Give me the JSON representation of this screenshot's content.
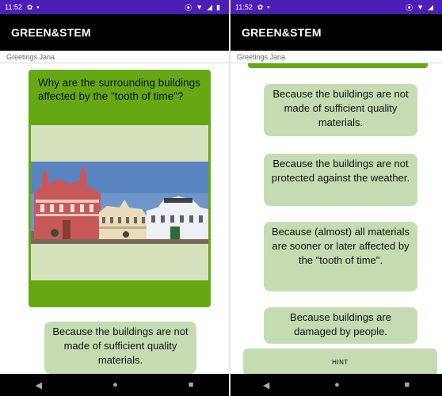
{
  "status_bar": {
    "time": "11:52"
  },
  "app": {
    "title": "GREEN&STEM",
    "greeting": "Greetings Jana"
  },
  "question": {
    "text": "Why are the surrounding buildings affected by the \"tooth of time\"?"
  },
  "answers": [
    "Because the buildings are not made of sufficient quality materials.",
    "Because the buildings are not protected against the weather.",
    "Because (almost) all materials are sooner or later affected by the \"tooth of time\".",
    "Because buildings are damaged by people."
  ],
  "hint_label": "HINT",
  "nav": {
    "back": "◀",
    "home": "●",
    "recents": "■"
  },
  "colors": {
    "status": "#4b1fb5",
    "appbar": "#000000",
    "card": "#65a814",
    "answer": "#c5dcb3"
  }
}
